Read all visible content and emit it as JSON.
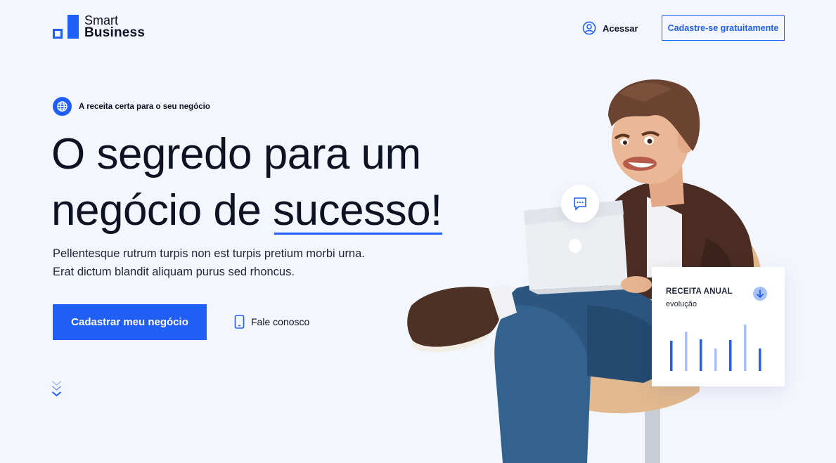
{
  "header": {
    "logo_line1": "Smart",
    "logo_line2": "Business",
    "login_label": "Acessar",
    "signup_label": "Cadastre-se gratuitamente"
  },
  "hero": {
    "eyebrow": "A receita certa para o seu negócio",
    "headline_line1": "O segredo para um",
    "headline_line2_prefix": "negócio de ",
    "headline_accent": "sucesso!",
    "lead_line1": "Pellentesque rutrum turpis non est turpis pretium morbi urna.",
    "lead_line2": "Erat dictum blandit aliquam purus sed rhoncus.",
    "cta_label": "Cadastrar meu negócio",
    "contact_label": "Fale conosco"
  },
  "card": {
    "title": "RECEITA ANUAL",
    "subtitle": "evolução",
    "bars": [
      {
        "value": 0.58,
        "color": "#1f5ff5"
      },
      {
        "value": 0.76,
        "color": "#a8c1f7"
      },
      {
        "value": 0.61,
        "color": "#1f5ff5"
      },
      {
        "value": 0.43,
        "color": "#a8c1f7"
      },
      {
        "value": 0.59,
        "color": "#1f5ff5"
      },
      {
        "value": 0.89,
        "color": "#a8c1f7"
      },
      {
        "value": 0.43,
        "color": "#1f5ff5"
      }
    ]
  },
  "icons": {
    "logo": "logo-mark",
    "user": "user-circle-icon",
    "globe": "globe-icon",
    "phone": "phone-icon",
    "chevrons": "double-chevron-down-icon",
    "chat": "chat-dots-icon",
    "download": "arrow-down-icon"
  },
  "colors": {
    "accent": "#1f5ff5",
    "accent_light": "#a8c1f7",
    "background": "#f4f6fd",
    "text": "#0e1222"
  }
}
